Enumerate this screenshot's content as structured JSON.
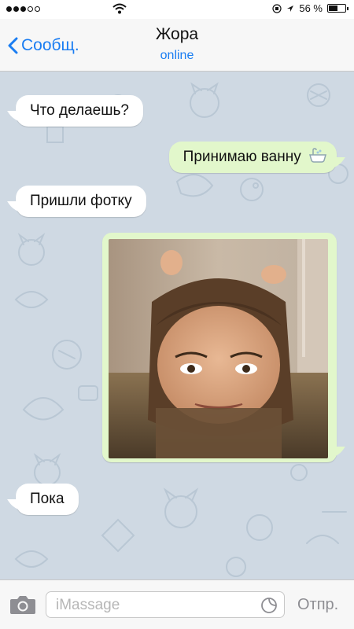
{
  "status_bar": {
    "battery_text": "56 %",
    "battery_level": 0.56
  },
  "header": {
    "back_label": "Сообщ.",
    "title": "Жора",
    "subtitle": "online"
  },
  "messages": [
    {
      "direction": "incoming",
      "text": "Что делаешь?"
    },
    {
      "direction": "outgoing",
      "text": "Принимаю ванну"
    },
    {
      "direction": "incoming",
      "text": "Пришли фотку"
    },
    {
      "direction": "outgoing",
      "type": "photo"
    },
    {
      "direction": "incoming",
      "text": "Пока"
    }
  ],
  "input_bar": {
    "placeholder": "iMassage",
    "send_label": "Отпр."
  },
  "colors": {
    "accent": "#1a7df2",
    "chat_bg": "#cfd9e3",
    "outgoing_bubble": "#e2f7cb",
    "incoming_bubble": "#ffffff"
  }
}
